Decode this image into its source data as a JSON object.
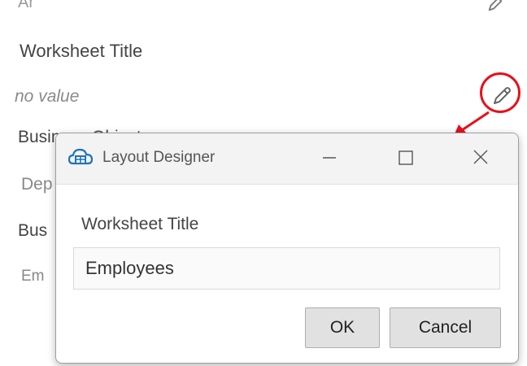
{
  "background": {
    "clipped_label": "Ar",
    "property_title": "Worksheet Title",
    "property_value": "no value",
    "row_labels": [
      "Business Object",
      "Dep",
      "Bus",
      "Em"
    ]
  },
  "dialog": {
    "title": "Layout Designer",
    "field_label": "Worksheet Title",
    "field_value": "Employees",
    "ok_label": "OK",
    "cancel_label": "Cancel"
  },
  "colors": {
    "annotation": "#e8101a",
    "app_icon": "#1f73b7"
  },
  "icons": [
    "pencil-icon",
    "layout-designer-app-icon",
    "minimize-icon",
    "maximize-icon",
    "close-icon",
    "arrow-annotation"
  ]
}
